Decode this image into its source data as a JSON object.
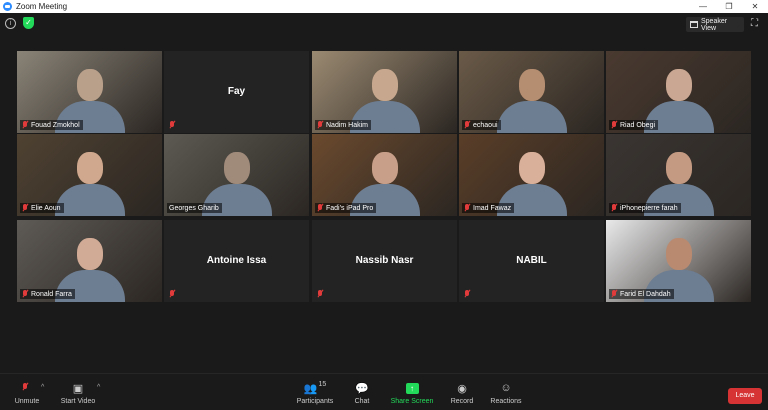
{
  "window": {
    "title": "Zoom Meeting",
    "controls": [
      "—",
      "❐",
      "✕"
    ]
  },
  "topbar": {
    "speaker_view_label": "Speaker View"
  },
  "tiles": [
    {
      "name": "Fouad Zmokhol",
      "muted": true,
      "video": true,
      "bg": "#8a8478",
      "face": "#b9a08a"
    },
    {
      "name": "Fay",
      "muted": true,
      "video": false
    },
    {
      "name": "Nadim Hakim",
      "muted": true,
      "video": true,
      "bg": "#9b8a72",
      "face": "#c7a88e"
    },
    {
      "name": "echaoui",
      "muted": true,
      "video": true,
      "bg": "#6a5a48",
      "face": "#b58d70"
    },
    {
      "name": "Riad Obegi",
      "muted": true,
      "video": true,
      "bg": "#4a3a30",
      "face": "#c9a792"
    },
    {
      "name": "Elie Aoun",
      "muted": true,
      "video": true,
      "bg": "#4f4232",
      "face": "#d0a88e"
    },
    {
      "name": "Georges Gharib",
      "muted": false,
      "video": true,
      "bg": "#5c5a52",
      "face": "#a08a7a",
      "active": true
    },
    {
      "name": "Fadi's iPad Pro",
      "muted": true,
      "video": true,
      "bg": "#6b4a2e",
      "face": "#c8a08a"
    },
    {
      "name": "Imad Fawaz",
      "muted": true,
      "video": true,
      "bg": "#5a3e28",
      "face": "#d9b09a"
    },
    {
      "name": "iPhonepierre farah",
      "muted": true,
      "video": true,
      "bg": "#3a3532",
      "face": "#c49a82"
    },
    {
      "name": "Ronald Farra",
      "muted": true,
      "video": true,
      "bg": "#5e5a56",
      "face": "#d2ab96"
    },
    {
      "name": "Antoine Issa",
      "muted": true,
      "video": false
    },
    {
      "name": "Nassib Nasr",
      "muted": true,
      "video": false
    },
    {
      "name": "NABIL",
      "muted": true,
      "video": false
    },
    {
      "name": "Farid El Dahdah",
      "muted": true,
      "video": true,
      "bg": "#e9e9ea",
      "face": "#b98a70"
    }
  ],
  "toolbar": {
    "unmute": "Unmute",
    "start_video": "Start Video",
    "participants": "Participants",
    "participants_count": "15",
    "chat": "Chat",
    "share_screen": "Share Screen",
    "record": "Record",
    "reactions": "Reactions",
    "leave": "Leave"
  }
}
